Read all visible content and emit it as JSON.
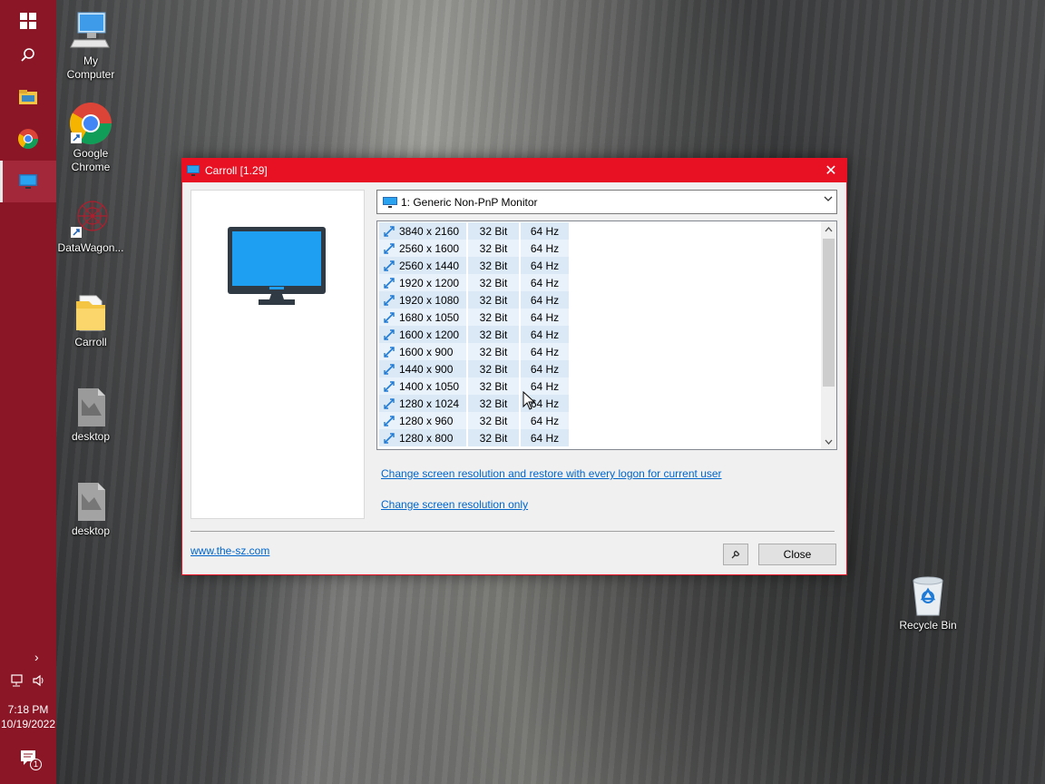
{
  "desktop": {
    "icons": [
      {
        "label": "My\nComputer",
        "icon": "computer-icon"
      },
      {
        "label": "Google\nChrome",
        "icon": "chrome-icon"
      },
      {
        "label": "DataWagon...",
        "icon": "datawagon-icon"
      },
      {
        "label": "Carroll",
        "icon": "folder-icon"
      },
      {
        "label": "desktop",
        "icon": "image-file-icon"
      },
      {
        "label": "desktop",
        "icon": "image-file-icon"
      },
      {
        "label": "Recycle Bin",
        "icon": "recycle-bin-icon"
      }
    ]
  },
  "taskbar": {
    "time": "7:18 PM",
    "date": "10/19/2022",
    "notification_count": "1",
    "accent": "#8a1626"
  },
  "window": {
    "title": "Carroll [1.29]",
    "accent": "#e81123",
    "monitor": "1: Generic Non-PnP Monitor",
    "resolutions": [
      {
        "res": "3840 x 2160",
        "bits": "32 Bit",
        "hz": "64 Hz"
      },
      {
        "res": "2560 x 1600",
        "bits": "32 Bit",
        "hz": "64 Hz"
      },
      {
        "res": "2560 x 1440",
        "bits": "32 Bit",
        "hz": "64 Hz"
      },
      {
        "res": "1920 x 1200",
        "bits": "32 Bit",
        "hz": "64 Hz"
      },
      {
        "res": "1920 x 1080",
        "bits": "32 Bit",
        "hz": "64 Hz"
      },
      {
        "res": "1680 x 1050",
        "bits": "32 Bit",
        "hz": "64 Hz"
      },
      {
        "res": "1600 x 1200",
        "bits": "32 Bit",
        "hz": "64 Hz"
      },
      {
        "res": "1600 x 900",
        "bits": "32 Bit",
        "hz": "64 Hz"
      },
      {
        "res": "1440 x 900",
        "bits": "32 Bit",
        "hz": "64 Hz"
      },
      {
        "res": "1400 x 1050",
        "bits": "32 Bit",
        "hz": "64 Hz"
      },
      {
        "res": "1280 x 1024",
        "bits": "32 Bit",
        "hz": "64 Hz"
      },
      {
        "res": "1280 x 960",
        "bits": "32 Bit",
        "hz": "64 Hz"
      },
      {
        "res": "1280 x 800",
        "bits": "32 Bit",
        "hz": "64 Hz"
      }
    ],
    "link_restore": "Change screen resolution and restore with every logon for current user",
    "link_only": "Change screen resolution only",
    "website": "www.the-sz.com",
    "close_label": "Close"
  }
}
